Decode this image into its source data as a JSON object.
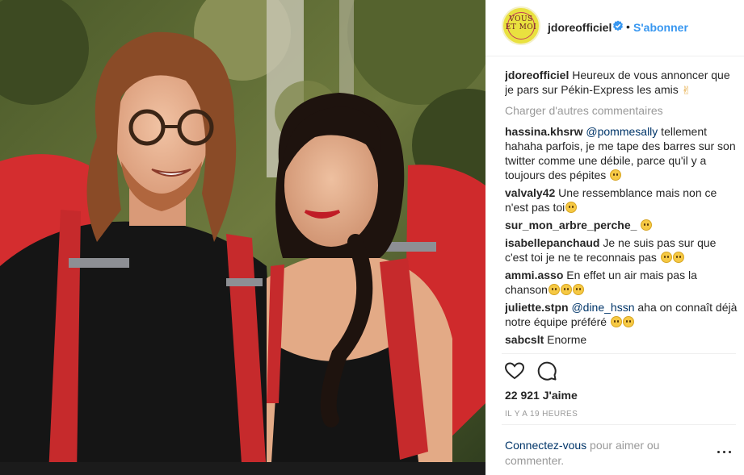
{
  "post": {
    "username": "jdoreofficiel",
    "separator_dot": "•",
    "follow_label": "S'abonner",
    "avatar_icon": "vous-et-moi-logo",
    "avatar_text": "VOUS ET MOI"
  },
  "caption": {
    "user": "jdoreofficiel",
    "text": " Heureux de vous annoncer que je pars sur Pékin-Express les amis "
  },
  "load_more": "Charger d'autres commentaires",
  "comments": [
    {
      "user": "hassina.khsrw",
      "mention": "@pommesally",
      "text": " tellement hahaha parfois, je me tape des barres sur son twitter comme une débile, parce qu'il y a toujours des pépites "
    },
    {
      "user": "valvaly42",
      "mention": "",
      "text": " Une ressemblance mais non ce n'est pas toi"
    },
    {
      "user": "sur_mon_arbre_perche_",
      "mention": "",
      "text": " "
    },
    {
      "user": "isabellepanchaud",
      "mention": "",
      "text": " Je ne suis pas sur que c'est toi je ne te reconnais pas "
    },
    {
      "user": "ammi.asso",
      "mention": "",
      "text": " En effet un air mais pas la chanson"
    },
    {
      "user": "juliette.stpn",
      "mention": "@dine_hssn",
      "text": " aha  on connaît déjà notre équipe préféré "
    },
    {
      "user": "sabcslt",
      "mention": "",
      "text": " Enorme"
    }
  ],
  "likes": "22 921 J'aime",
  "timestamp": "IL Y A 19 HEURES",
  "login": {
    "link": "Connectez-vous",
    "rest": " pour aimer ou commenter."
  },
  "icons": {
    "like": "heart-icon",
    "comment": "comment-bubble-icon",
    "options": "more-options-icon",
    "verified": "verified-badge-icon"
  },
  "colors": {
    "follow": "#3897f0",
    "mention": "#003569",
    "muted": "#999999",
    "verified": "#3897f0"
  }
}
